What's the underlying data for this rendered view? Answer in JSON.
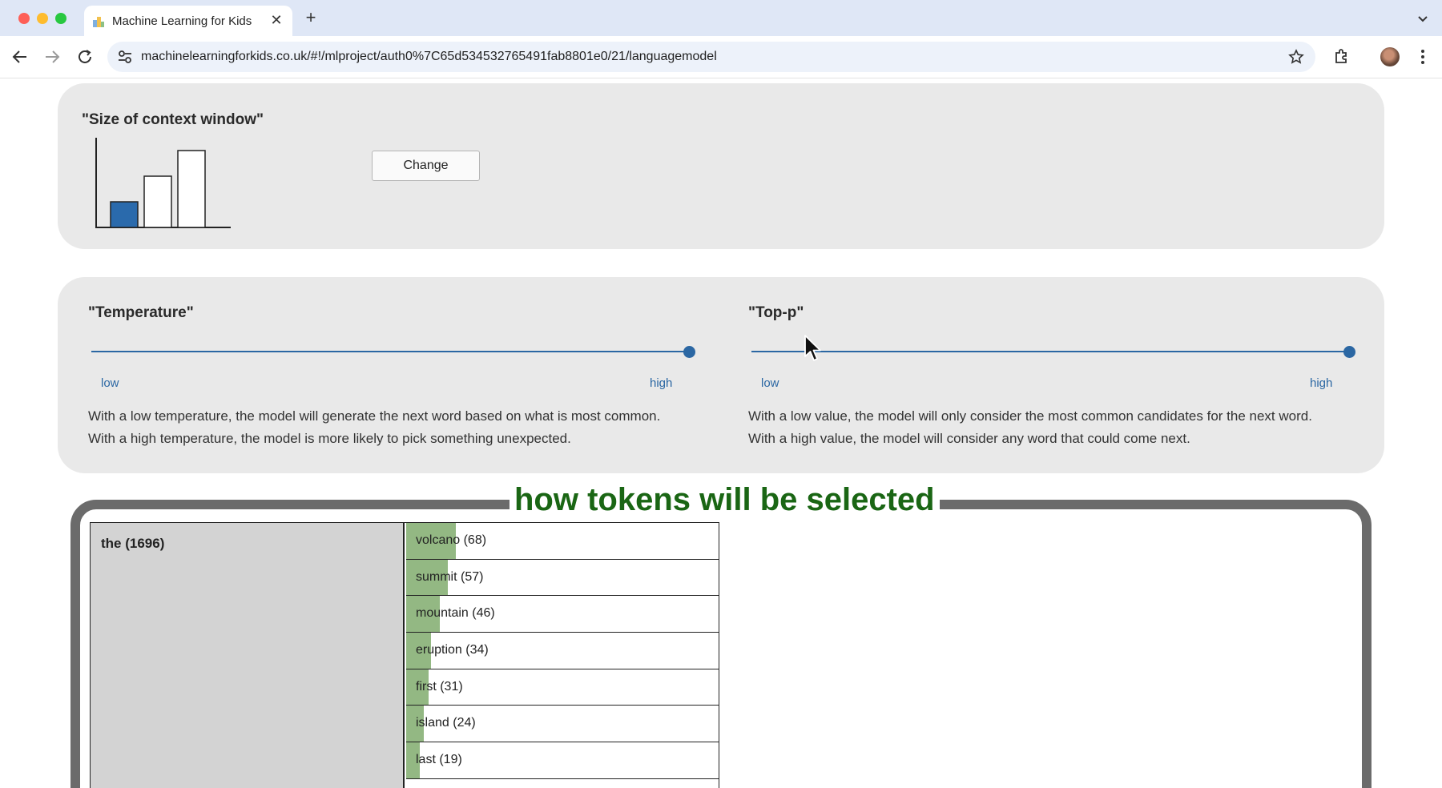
{
  "browser": {
    "tab_title": "Machine Learning for Kids",
    "url": "machinelearningforkids.co.uk/#!/mlproject/auth0%7C65d534532765491fab8801e0/21/languagemodel"
  },
  "context_window": {
    "title": "\"Size of context window\"",
    "change_label": "Change",
    "selected_size": "small"
  },
  "temperature": {
    "title": "\"Temperature\"",
    "low_label": "low",
    "high_label": "high",
    "value": 1.0,
    "description_line1": "With a low temperature, the model will generate the next word based on what is most common.",
    "description_line2": "With a high temperature, the model is more likely to pick something unexpected."
  },
  "top_p": {
    "title": "\"Top-p\"",
    "low_label": "low",
    "high_label": "high",
    "value": 1.0,
    "description_line1": "With a low value, the model will only consider the most common candidates for the next word.",
    "description_line2": "With a high value, the model will consider any word that could come next."
  },
  "tokens": {
    "heading": "how tokens will be selected",
    "root": "the (1696)",
    "candidates": [
      {
        "label": "volcano (68)",
        "count": 68
      },
      {
        "label": "summit (57)",
        "count": 57
      },
      {
        "label": "mountain (46)",
        "count": 46
      },
      {
        "label": "eruption (34)",
        "count": 34
      },
      {
        "label": "first (31)",
        "count": 31
      },
      {
        "label": "island (24)",
        "count": 24
      },
      {
        "label": "last (19)",
        "count": 19
      }
    ]
  },
  "colors": {
    "accent_blue": "#2b67a3",
    "heading_green": "#1a6614",
    "bar_green": "#93b883",
    "panel_grey": "#e9e9e9",
    "frame_grey": "#6b6b6b"
  }
}
